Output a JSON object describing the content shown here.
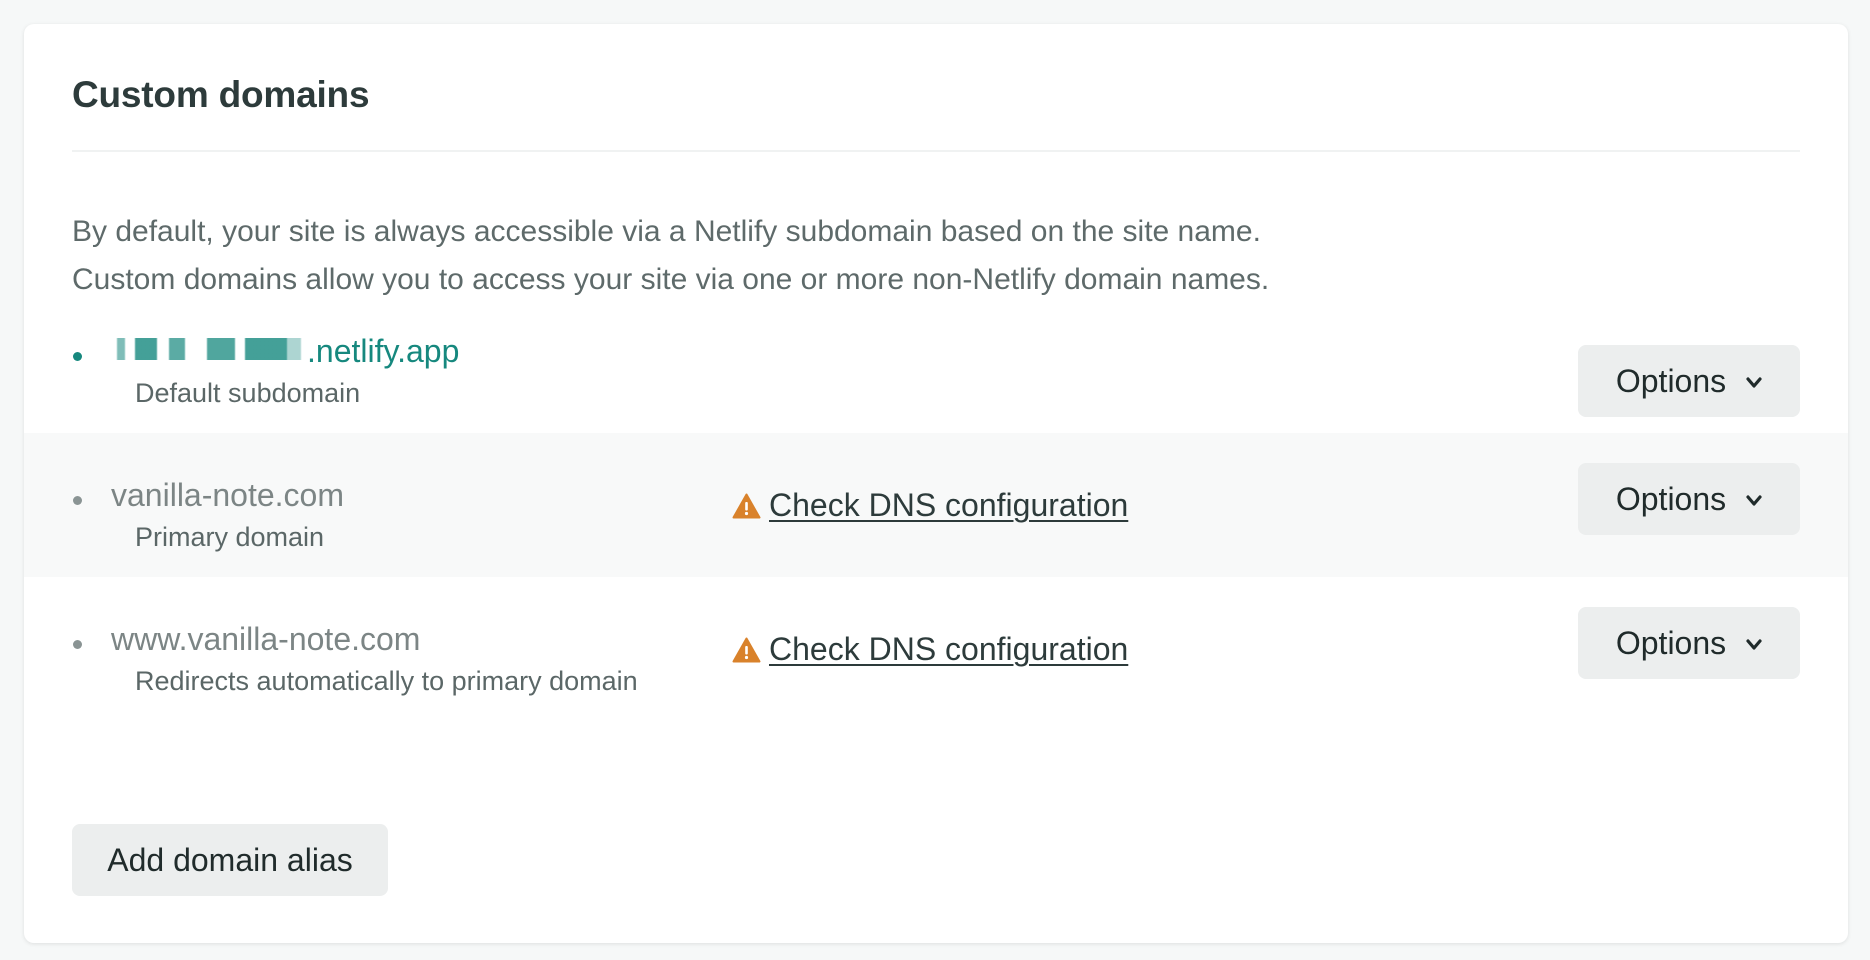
{
  "section": {
    "title": "Custom domains",
    "description_line1": "By default, your site is always accessible via a Netlify subdomain based on the site name.",
    "description_line2": "Custom domains allow you to access your site via one or more non-Netlify domain names."
  },
  "domains": [
    {
      "name_suffix": ".netlify.app",
      "subtitle": "Default subdomain",
      "options_label": "Options",
      "name_redacted": true
    },
    {
      "name": "vanilla-note.com",
      "subtitle": "Primary domain",
      "dns_warning": "Check DNS configuration",
      "options_label": "Options"
    },
    {
      "name": "www.vanilla-note.com",
      "subtitle": "Redirects automatically to primary domain",
      "dns_warning": "Check DNS configuration",
      "options_label": "Options"
    }
  ],
  "add_alias_label": "Add domain alias",
  "icons": {
    "warning": "warning-triangle-icon",
    "chevron": "chevron-down-icon"
  },
  "colors": {
    "accent_teal": "#16887e",
    "warning_orange": "#d9822b",
    "button_bg": "#eceeee"
  }
}
